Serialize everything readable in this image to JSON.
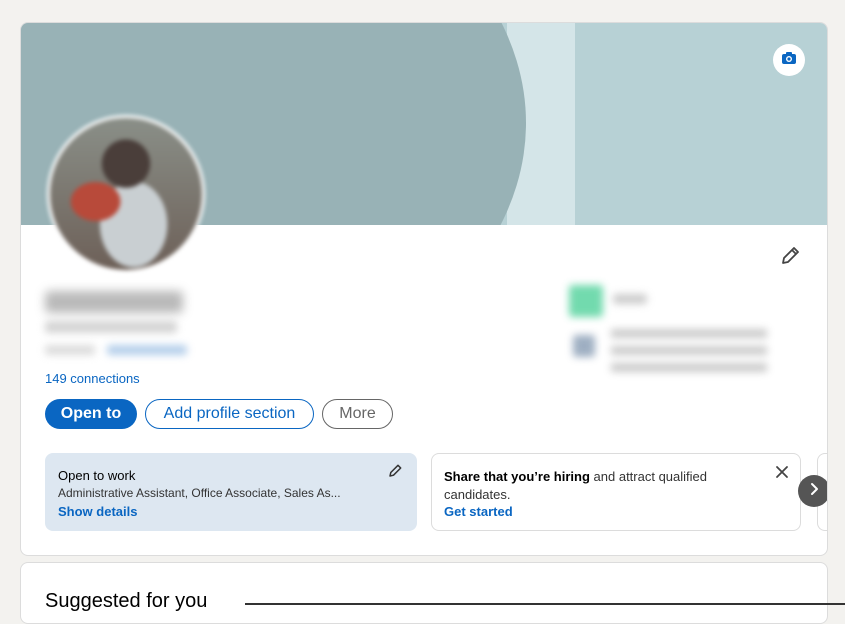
{
  "profile": {
    "connections": "149 connections",
    "actions": {
      "open_to": "Open to",
      "add_section": "Add profile section",
      "more": "More"
    }
  },
  "open_to_work": {
    "title": "Open to work",
    "roles": "Administrative Assistant, Office Associate, Sales As...",
    "link": "Show details"
  },
  "hiring": {
    "strong": "Share that you’re hiring",
    "rest": " and attract qualified candidates.",
    "link": "Get started"
  },
  "suggested": {
    "title": "Suggested for you"
  },
  "colors": {
    "accent": "#0a66c2",
    "banner": "#b7d1d5",
    "open_to_work_bg": "#dde7f1"
  },
  "icons": [
    "camera-icon",
    "pencil-icon",
    "close-icon",
    "chevron-right-icon"
  ]
}
